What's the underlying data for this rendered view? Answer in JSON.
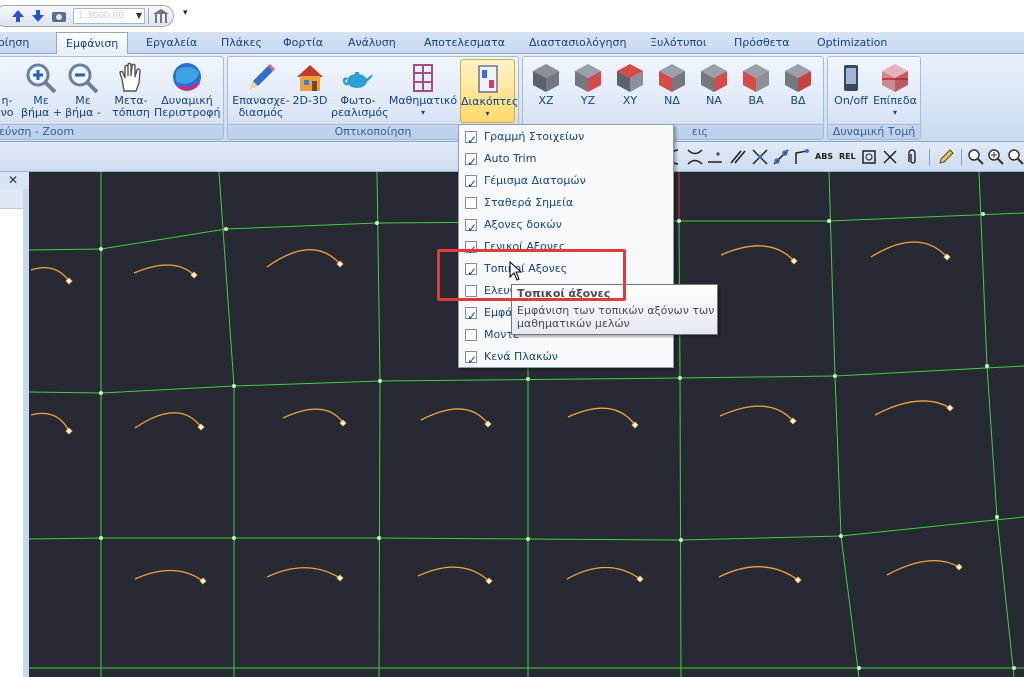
{
  "quick_access": {
    "zoom_value": "1:3000.00",
    "customize_glyph": "▾"
  },
  "tabs": [
    "οίηση",
    "Εμφάνιση",
    "Εργαλεία",
    "Πλάκες",
    "Φορτία",
    "Ανάλυση",
    "Αποτελεσματα",
    "Διαστασιολόγηση",
    "Ξυλότυποι",
    "Πρόσθετα",
    "Optimization"
  ],
  "active_tab": "Εμφάνιση",
  "ribbon": {
    "groups": {
      "zoom": "εύνση - Zoom",
      "visualization": "Οπτικοποίηση",
      "views": "εις",
      "section": "Δυναμική Τομή"
    },
    "buttons": {
      "partial_1": "η-",
      "partial_2": "νο",
      "step_plus_1": "Με",
      "step_plus_2": "βήμα +",
      "step_minus_1": "Με",
      "step_minus_2": "βήμα -",
      "move_1": "Μετα-",
      "move_2": "τόπιση",
      "rotate_1": "Δυναμική",
      "rotate_2": "Περιστροφή",
      "redraw_1": "Επανασχε-",
      "redraw_2": "διασμός",
      "mode_2d3d": "2D-3D",
      "photo_1": "Φωτο-",
      "photo_2": "ρεαλισμός",
      "math": "Μαθηματικό",
      "switches": "Διακόπτες",
      "xz": "XZ",
      "yz": "YZ",
      "xy": "XY",
      "nd": "ΝΔ",
      "na": "ΝΑ",
      "va": "ΒΑ",
      "vd": "ΒΔ",
      "onoff": "On/off",
      "planes": "Επίπεδα"
    }
  },
  "toolbar2": {
    "abs_label": "ABS",
    "rel_label": "REL"
  },
  "left_panel": {
    "close_glyph": "✕"
  },
  "menu": {
    "items": [
      {
        "label": "Γραμμή Στοιχείων",
        "checked": true
      },
      {
        "label": "Auto Trim",
        "checked": true
      },
      {
        "label": "Γέμισμα Διατομών",
        "checked": true
      },
      {
        "label": "Σταθερά Σημεία",
        "checked": false
      },
      {
        "label": "Αξονες δοκών",
        "checked": true
      },
      {
        "label": "Γενικοί Αξονες",
        "checked": true
      },
      {
        "label": "Τοπικοί Αξονες",
        "checked": true
      },
      {
        "label": "Ελευθ",
        "checked": false
      },
      {
        "label": "Εμφά",
        "checked": true
      },
      {
        "label": "Μοντέ",
        "checked": false
      },
      {
        "label": "Κενά Πλακών",
        "checked": true
      }
    ]
  },
  "tooltip": {
    "title": "Τοπικοί άξονες",
    "body": "Εμφάνιση των τοπικών  αξόνων των μαθηματικών  μελών"
  },
  "colors": {
    "canvas_bg": "#272a33",
    "grid_line": "#3ed23e",
    "arc": "#f2a23a",
    "highlight": "#e03a3a",
    "ribbon_text": "#15428b"
  }
}
